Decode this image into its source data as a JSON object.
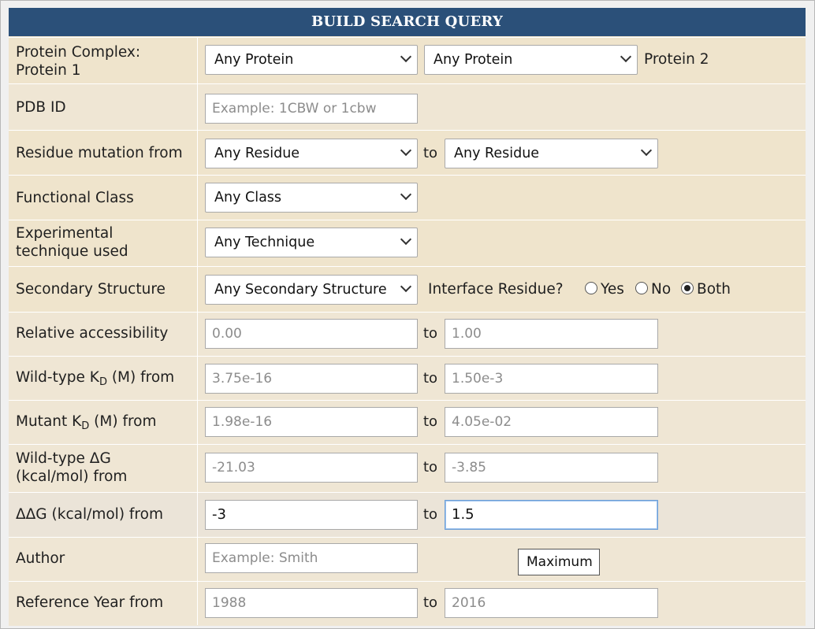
{
  "header": {
    "title": "BUILD SEARCH QUERY"
  },
  "rows": {
    "protein": {
      "label_line1": "Protein Complex:",
      "label_line2": "Protein 1",
      "protein1_value": "Any Protein",
      "protein2_value": "Any Protein",
      "protein2_label": "Protein 2"
    },
    "pdb": {
      "label": "PDB ID",
      "placeholder": "Example: 1CBW or 1cbw"
    },
    "residue": {
      "label": "Residue mutation from",
      "from_value": "Any Residue",
      "to_label": "to",
      "to_value": "Any Residue"
    },
    "functional": {
      "label": "Functional Class",
      "value": "Any Class"
    },
    "technique": {
      "label_line1": "Experimental",
      "label_line2": "technique used",
      "value": "Any Technique"
    },
    "secondary": {
      "label": "Secondary Structure",
      "value": "Any Secondary Structure",
      "interface_label": "Interface Residue?",
      "options": [
        "Yes",
        "No",
        "Both"
      ],
      "selected": "Both"
    },
    "accessibility": {
      "label": "Relative accessibility",
      "from_placeholder": "0.00",
      "to_label": "to",
      "to_placeholder": "1.00"
    },
    "wt_kd": {
      "label_pre": "Wild-type K",
      "label_sub": "D",
      "label_post": " (M) from",
      "from_placeholder": "3.75e-16",
      "to_label": "to",
      "to_placeholder": "1.50e-3"
    },
    "mut_kd": {
      "label_pre": "Mutant K",
      "label_sub": "D",
      "label_post": " (M) from",
      "from_placeholder": "1.98e-16",
      "to_label": "to",
      "to_placeholder": "4.05e-02"
    },
    "wt_dg": {
      "label_line1": "Wild-type ΔG",
      "label_line2": "(kcal/mol) from",
      "from_placeholder": "-21.03",
      "to_label": "to",
      "to_placeholder": "-3.85"
    },
    "ddg": {
      "label": "ΔΔG (kcal/mol) from",
      "from_value": "-3",
      "to_label": "to",
      "to_value": "1.5"
    },
    "author": {
      "label": "Author",
      "placeholder": "Example: Smith",
      "button_label": "Maximum"
    },
    "year": {
      "label": "Reference Year from",
      "from_placeholder": "1988",
      "to_label": "to",
      "to_placeholder": "2016"
    }
  },
  "colors": {
    "header_bg": "#2b5079",
    "panel_bg": "#efe4cc"
  }
}
